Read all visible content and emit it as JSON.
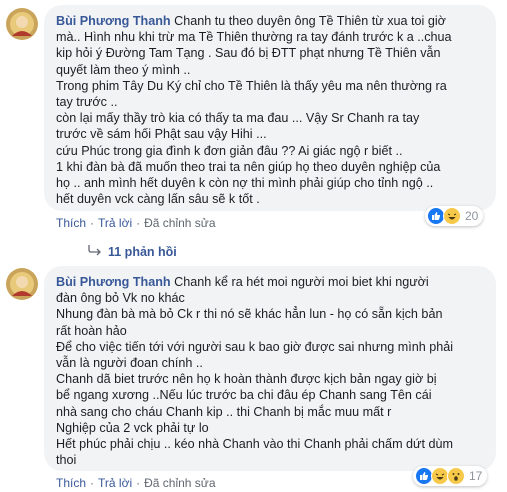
{
  "comments": [
    {
      "author": "Bùi Phương Thanh",
      "lines": [
        "Chanh tu theo duyên ông Tề Thiên từ xua toi giờ",
        "mà.. Hình nhu khi trừ ma Tề Thiên thường ra tay đánh trước k a ..chua",
        "kip hỏi ý Đường Tam Tạng . Sau đó bị ĐTT phạt nhưng Tề Thiên vẫn",
        "quyết làm theo ý mình ..",
        "Trong phim Tây Du Ký chỉ cho Tề Thiên là thấy yêu ma nên thường ra",
        "tay trước ..",
        "còn lại mấy thầy trò kia có thấy ta ma đau ... Vậy Sr Chanh ra tay",
        "trước về sám hối Phật sau vậy Hihi ...",
        "cứu Phúc trong gia đình k đơn giản đâu ?? Ai giác ngộ r biết ..",
        "1 khi đàn bà đã muốn theo trai ta nên giúp họ theo duyên nghiệp của",
        "họ .. anh mình hết duyên k còn nợ thi mình phải giúp cho tỉnh ngộ ..",
        "hết duyên vck càng lấn sâu sẽ k tốt ."
      ],
      "like_label": "Thích",
      "reply_label": "Trả lời",
      "edited_label": "Đã chỉnh sửa",
      "reaction_count": "20",
      "replies_label": "11 phản hồi"
    },
    {
      "author": "Bùi Phương Thanh",
      "lines": [
        "Chanh kể ra hét moi người moi biet khi người",
        "đàn ông bỏ Vk no khác",
        "Nhung đàn bà mà bỏ Ck r thi nó sẽ khác hẳn lun - họ có sẵn kịch bản",
        "rất hoàn hảo",
        "Để cho việc tiến tới với người sau k bao giờ được sai nhưng mình phải",
        "vẫn là người đoan chính ..",
        "Chanh dã biet trước nên họ k hoàn thành được kịch bản ngay giờ bị",
        "bể ngang xương ..Nếu lúc trước ba chi đâu ép Chanh sang Tên cái",
        "nhà sang cho cháu Chanh kip .. thi Chanh bị mắc muu mất r",
        "Nghiệp của 2 vck phải tự lo",
        "Hết phúc phải chịu .. kéo nhà Chanh vào thi Chanh phải chấm dứt dùm",
        "thoi"
      ],
      "like_label": "Thích",
      "reply_label": "Trả lời",
      "edited_label": "Đã chỉnh sửa",
      "reaction_count": "17"
    }
  ],
  "icons": {
    "like": "like-icon",
    "haha": "haha-icon",
    "wow": "wow-icon",
    "reply_arrow": "reply-arrow-icon"
  },
  "colors": {
    "link": "#385898",
    "bubble": "#f2f3f5",
    "like_blue": "#1877f2",
    "haha_yellow": "#f7c94b"
  }
}
